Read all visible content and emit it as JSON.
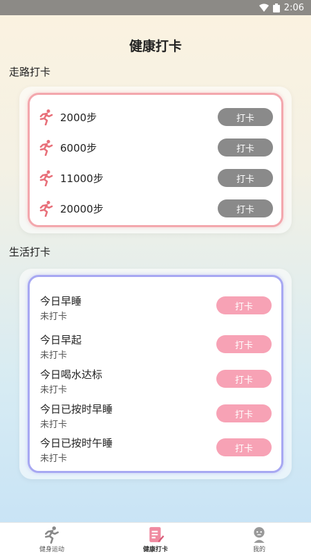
{
  "status_bar": {
    "time": "2:06"
  },
  "page_title": "健康打卡",
  "walk_section": {
    "title": "走路打卡",
    "items": [
      {
        "label": "2000步",
        "button": "打卡"
      },
      {
        "label": "6000步",
        "button": "打卡"
      },
      {
        "label": "11000步",
        "button": "打卡"
      },
      {
        "label": "20000步",
        "button": "打卡"
      }
    ]
  },
  "life_section": {
    "title": "生活打卡",
    "items": [
      {
        "title": "今日早睡",
        "status": "未打卡",
        "button": "打卡"
      },
      {
        "title": "今日早起",
        "status": "未打卡",
        "button": "打卡"
      },
      {
        "title": "今日喝水达标",
        "status": "未打卡",
        "button": "打卡"
      },
      {
        "title": "今日已按时早睡",
        "status": "未打卡",
        "button": "打卡"
      },
      {
        "title": "今日已按时午睡",
        "status": "未打卡",
        "button": "打卡"
      }
    ]
  },
  "tab_bar": {
    "tabs": [
      {
        "label": "健身运动",
        "icon": "running-icon"
      },
      {
        "label": "健康打卡",
        "icon": "checkin-icon",
        "active": true
      },
      {
        "label": "我的",
        "icon": "profile-icon"
      }
    ]
  },
  "colors": {
    "walk_border": "#f3a7ad",
    "life_border": "#a7a8f2",
    "gray_button": "#8a8a8a",
    "pink_button": "#f7a2b5",
    "run_icon": "#e8707a"
  }
}
